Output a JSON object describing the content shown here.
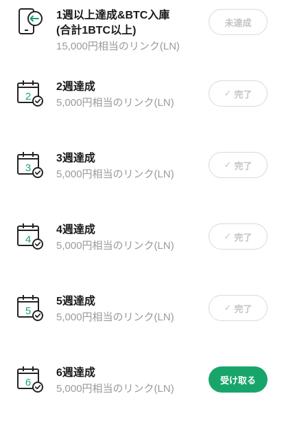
{
  "accent_color": "#18a56b",
  "missions": [
    {
      "icon": "phone-deposit-icon",
      "title": "1週以上達成&BTC入庫\n(合計1BTC以上)",
      "reward": "15,000円相当のリンク(LN)",
      "status": "未達成"
    },
    {
      "icon": "calendar-week-2-icon",
      "week_number": "2",
      "title": "2週達成",
      "reward": "5,000円相当のリンク(LN)",
      "status": "完了"
    },
    {
      "icon": "calendar-week-3-icon",
      "week_number": "3",
      "title": "3週達成",
      "reward": "5,000円相当のリンク(LN)",
      "status": "完了"
    },
    {
      "icon": "calendar-week-4-icon",
      "week_number": "4",
      "title": "4週達成",
      "reward": "5,000円相当のリンク(LN)",
      "status": "完了"
    },
    {
      "icon": "calendar-week-5-icon",
      "week_number": "5",
      "title": "5週達成",
      "reward": "5,000円相当のリンク(LN)",
      "status": "完了"
    },
    {
      "icon": "calendar-week-6-icon",
      "week_number": "6",
      "title": "6週達成",
      "reward": "5,000円相当のリンク(LN)",
      "status": "受け取る"
    }
  ]
}
